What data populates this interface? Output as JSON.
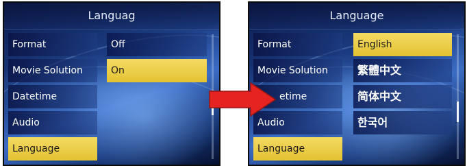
{
  "before": {
    "title": "Languag",
    "menu": [
      {
        "label": "Format",
        "selected": false
      },
      {
        "label": "Movie Solution",
        "selected": false
      },
      {
        "label": "Datetime",
        "selected": false
      },
      {
        "label": "Audio",
        "selected": false
      },
      {
        "label": "Language",
        "selected": true
      }
    ],
    "options": [
      {
        "label": "Off",
        "selected": false
      },
      {
        "label": "On",
        "selected": true
      }
    ]
  },
  "after": {
    "title": "Language",
    "menu": [
      {
        "label": "Format",
        "selected": false
      },
      {
        "label": "Movie Solution",
        "selected": false
      },
      {
        "label": "etime",
        "selected": false
      },
      {
        "label": "Audio",
        "selected": false
      },
      {
        "label": "Language",
        "selected": true
      }
    ],
    "options": [
      {
        "label": "English",
        "selected": true
      },
      {
        "label": "繁體中文",
        "selected": false
      },
      {
        "label": "简体中文",
        "selected": false
      },
      {
        "label": "한국어",
        "selected": false
      }
    ]
  },
  "colors": {
    "highlight": "#e8c83a",
    "arrow": "#e52421"
  }
}
